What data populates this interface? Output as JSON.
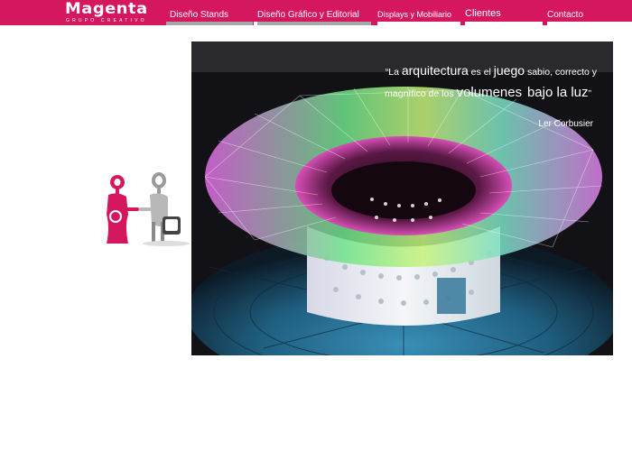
{
  "brand": {
    "name": "Magenta",
    "tagline": "GRUPO CREATIVO",
    "color": "#d4175f"
  },
  "nav": {
    "items": [
      {
        "label": "Diseño Stands",
        "underline_color": "#a8a8a8"
      },
      {
        "label": "Diseño Gráfico y Editorial",
        "underline_color": "#a8a8a8"
      },
      {
        "label": "Displays y Mobiliario",
        "underline_color": "#ffffff"
      },
      {
        "label": "Clientes",
        "underline_color": "#ffffff"
      },
      {
        "label": "Contacto",
        "underline_color": "#ffffff"
      }
    ]
  },
  "quote": {
    "line1_pre": "“La ",
    "line1_w1": "arquitectura",
    "line1_mid": " es el ",
    "line1_w2": "juego",
    "line1_post": " sabio, correcto y",
    "line2_pre": "magnífico de los ",
    "line2_w1": "volumenes",
    "line2_gap": "  ",
    "line2_w2": "bajo la luz",
    "line2_post": "”",
    "author": "Ler Corbusier"
  },
  "colors": {
    "hero_bg": "#141418",
    "accent": "#d4175f"
  }
}
